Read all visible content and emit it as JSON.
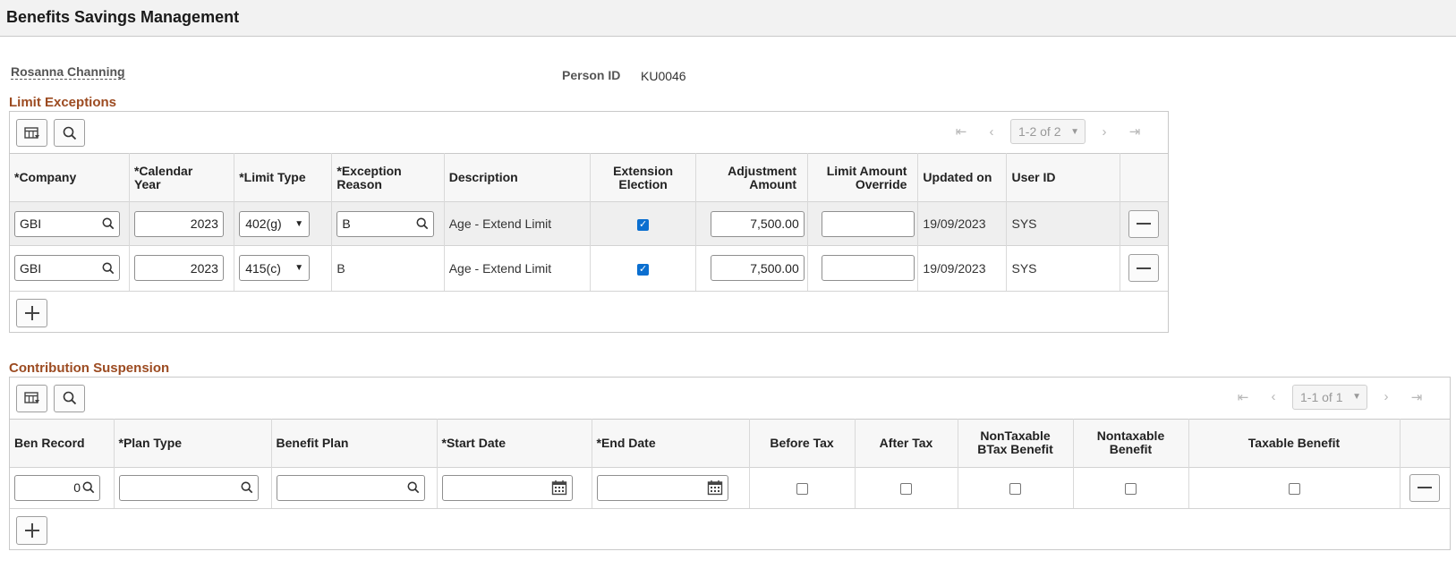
{
  "page": {
    "title": "Benefits Savings Management"
  },
  "person": {
    "name": "Rosanna Channing",
    "id_label": "Person ID",
    "id_value": "KU0046"
  },
  "limit_exceptions": {
    "title": "Limit Exceptions",
    "pager": {
      "text": "1-2 of 2"
    },
    "columns": {
      "company": "*Company",
      "calendar_year_1": "*Calendar",
      "calendar_year_2": "Year",
      "limit_type": "*Limit Type",
      "exception_reason_1": "*Exception",
      "exception_reason_2": "Reason",
      "description": "Description",
      "extension_election_1": "Extension",
      "extension_election_2": "Election",
      "adjustment_amount_1": "Adjustment",
      "adjustment_amount_2": "Amount",
      "limit_override_1": "Limit Amount",
      "limit_override_2": "Override",
      "updated_on": "Updated on",
      "user_id": "User ID"
    },
    "rows": [
      {
        "company": "GBI",
        "year": "2023",
        "limit_type": "402(g)",
        "reason": "B",
        "description": "Age - Extend Limit",
        "extension": true,
        "adjustment": "7,500.00",
        "override": "",
        "updated_on": "19/09/2023",
        "user_id": "SYS"
      },
      {
        "company": "GBI",
        "year": "2023",
        "limit_type": "415(c)",
        "reason": "B",
        "description": "Age - Extend Limit",
        "extension": true,
        "adjustment": "7,500.00",
        "override": "",
        "updated_on": "19/09/2023",
        "user_id": "SYS"
      }
    ]
  },
  "contribution_suspension": {
    "title": "Contribution Suspension",
    "pager": {
      "text": "1-1 of 1"
    },
    "columns": {
      "ben_record": "Ben Record",
      "plan_type": "*Plan Type",
      "benefit_plan": "Benefit Plan",
      "start_date": "*Start Date",
      "end_date": "*End Date",
      "before_tax": "Before Tax",
      "after_tax": "After Tax",
      "nontaxable_btax_1": "NonTaxable",
      "nontaxable_btax_2": "BTax Benefit",
      "nontaxable_benefit_1": "Nontaxable",
      "nontaxable_benefit_2": "Benefit",
      "taxable_benefit": "Taxable Benefit"
    },
    "rows": [
      {
        "ben_record": "0",
        "plan_type": "",
        "benefit_plan": "",
        "start_date": "",
        "end_date": "",
        "before_tax": false,
        "after_tax": false,
        "nontaxable_btax": false,
        "nontaxable_benefit": false,
        "taxable_benefit": false
      }
    ]
  },
  "icons": {
    "grid_personalize": "table-settings-icon",
    "find": "search-icon",
    "first": "first-page-icon",
    "prev": "previous-page-icon",
    "next": "next-page-icon",
    "last": "last-page-icon",
    "lookup": "lookup-search-icon",
    "calendar": "calendar-icon",
    "delete_row": "minus-icon",
    "add_row": "plus-icon"
  },
  "colors": {
    "section_title": "#9c4b21",
    "checkbox_checked": "#0b6fd0",
    "header_bg": "#f2f2f2"
  }
}
